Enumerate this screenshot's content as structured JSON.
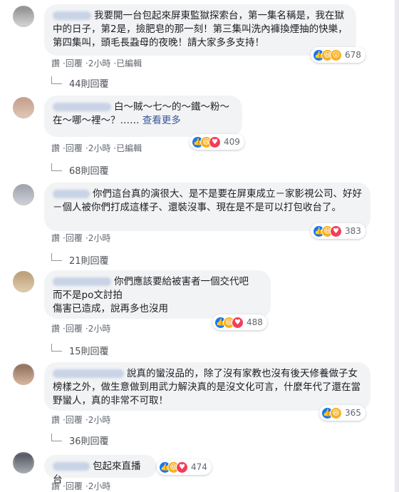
{
  "comments": [
    {
      "text": "我要開一台包起來屏東監獄探索台，第一集名稱是，我在獄中的日子，第2是，撿肥皂的那一刻！第三集叫洗內褲換煙抽的快樂，第四集叫，頭毛長蝨母的夜晚！請大家多多支持！",
      "reaction_count": "678",
      "reactions": [
        "like-icon",
        "haha-icon",
        "wow-icon"
      ],
      "actions": [
        "讚",
        "回覆",
        "2小時",
        "已編輯"
      ],
      "replies": "44則回覆"
    },
    {
      "text": "白～賊～七～的～鐵～粉～在～哪～裡～？……",
      "see_more": "查看更多",
      "reaction_count": "409",
      "reactions": [
        "like-icon",
        "haha-icon",
        "love-icon"
      ],
      "actions": [
        "讚",
        "回覆",
        "2小時",
        "已編輯"
      ],
      "replies": "68則回覆"
    },
    {
      "text": "你們這台真的演很大、是不是要在屏東成立－家影視公司、好好－個人被你們打成這樣子、還裝沒事、現在是不是可以打包收台了。",
      "reaction_count": "383",
      "reactions": [
        "like-icon",
        "haha-icon",
        "love-icon"
      ],
      "actions": [
        "讚",
        "回覆",
        "2小時"
      ],
      "replies": "21則回覆"
    },
    {
      "text": "你們應該要給被害者一個交代吧\n而不是po文討拍\n傷害已造成，說再多也沒用",
      "reaction_count": "488",
      "reactions": [
        "like-icon",
        "haha-icon",
        "love-icon"
      ],
      "actions": [
        "讚",
        "回覆",
        "2小時"
      ],
      "replies": "15則回覆"
    },
    {
      "text": "說真的蠻沒品的，除了沒有家教也沒有後天修養做子女榜樣之外，做生意做到用武力解決真的是沒文化可言，什麼年代了還在當野蠻人，真的非常不可取！",
      "reaction_count": "365",
      "reactions": [
        "like-icon",
        "haha-icon"
      ],
      "actions": [
        "讚",
        "回覆",
        "2小時"
      ],
      "replies": "36則回覆"
    },
    {
      "text": "包起來直播台",
      "reaction_count": "474",
      "reactions": [
        "like-icon",
        "haha-icon",
        "love-icon"
      ],
      "actions": [
        "讚",
        "回覆",
        "2小時"
      ]
    }
  ],
  "colors": {
    "link": "#385898",
    "bubble": "#f2f3f5",
    "like": "#1877f2",
    "haha": "#f7b125",
    "love": "#f33e58"
  }
}
